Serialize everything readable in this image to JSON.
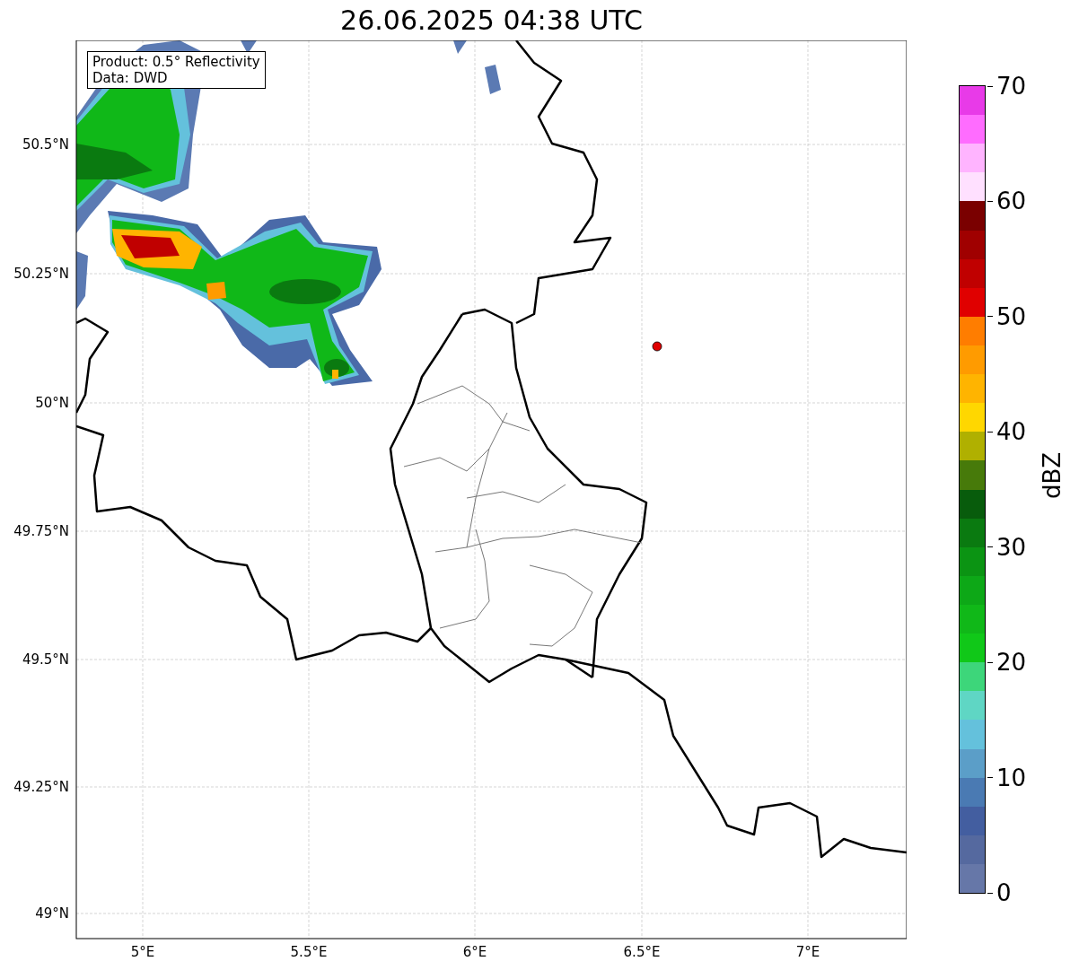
{
  "title": "26.06.2025 04:38 UTC",
  "map": {
    "legend": [
      "Product: 0.5° Reflectivity",
      "Data: DWD"
    ],
    "lat_ticks": [
      "50.5°N",
      "50.25°N",
      "50°N",
      "49.75°N",
      "49.5°N",
      "49.25°N",
      "49°N"
    ],
    "lon_ticks": [
      "5°E",
      "5.5°E",
      "6°E",
      "6.5°E",
      "7°E"
    ]
  },
  "colorbar": {
    "label": "dBZ",
    "ticks": [
      "70",
      "60",
      "50",
      "40",
      "30",
      "20",
      "10",
      "0"
    ],
    "segments": [
      {
        "color": "#e83ae8"
      },
      {
        "color": "#ff6cff"
      },
      {
        "color": "#ffb4ff"
      },
      {
        "color": "#ffe0ff"
      },
      {
        "color": "#7a0000"
      },
      {
        "color": "#a00000"
      },
      {
        "color": "#c00000"
      },
      {
        "color": "#e00000"
      },
      {
        "color": "#ff7d00"
      },
      {
        "color": "#ff9b00"
      },
      {
        "color": "#ffb400"
      },
      {
        "color": "#ffd700"
      },
      {
        "color": "#b0b000"
      },
      {
        "color": "#477a0a"
      },
      {
        "color": "#085c0c"
      },
      {
        "color": "#0a7a10"
      },
      {
        "color": "#0b9413"
      },
      {
        "color": "#0da817"
      },
      {
        "color": "#10b818"
      },
      {
        "color": "#10c818"
      },
      {
        "color": "#3dd67a"
      },
      {
        "color": "#5fd6c4"
      },
      {
        "color": "#64c1dc"
      },
      {
        "color": "#5b9ec8"
      },
      {
        "color": "#4a7ab3"
      },
      {
        "color": "#435ea0"
      },
      {
        "color": "#55699f"
      },
      {
        "color": "#6677a8"
      }
    ]
  }
}
